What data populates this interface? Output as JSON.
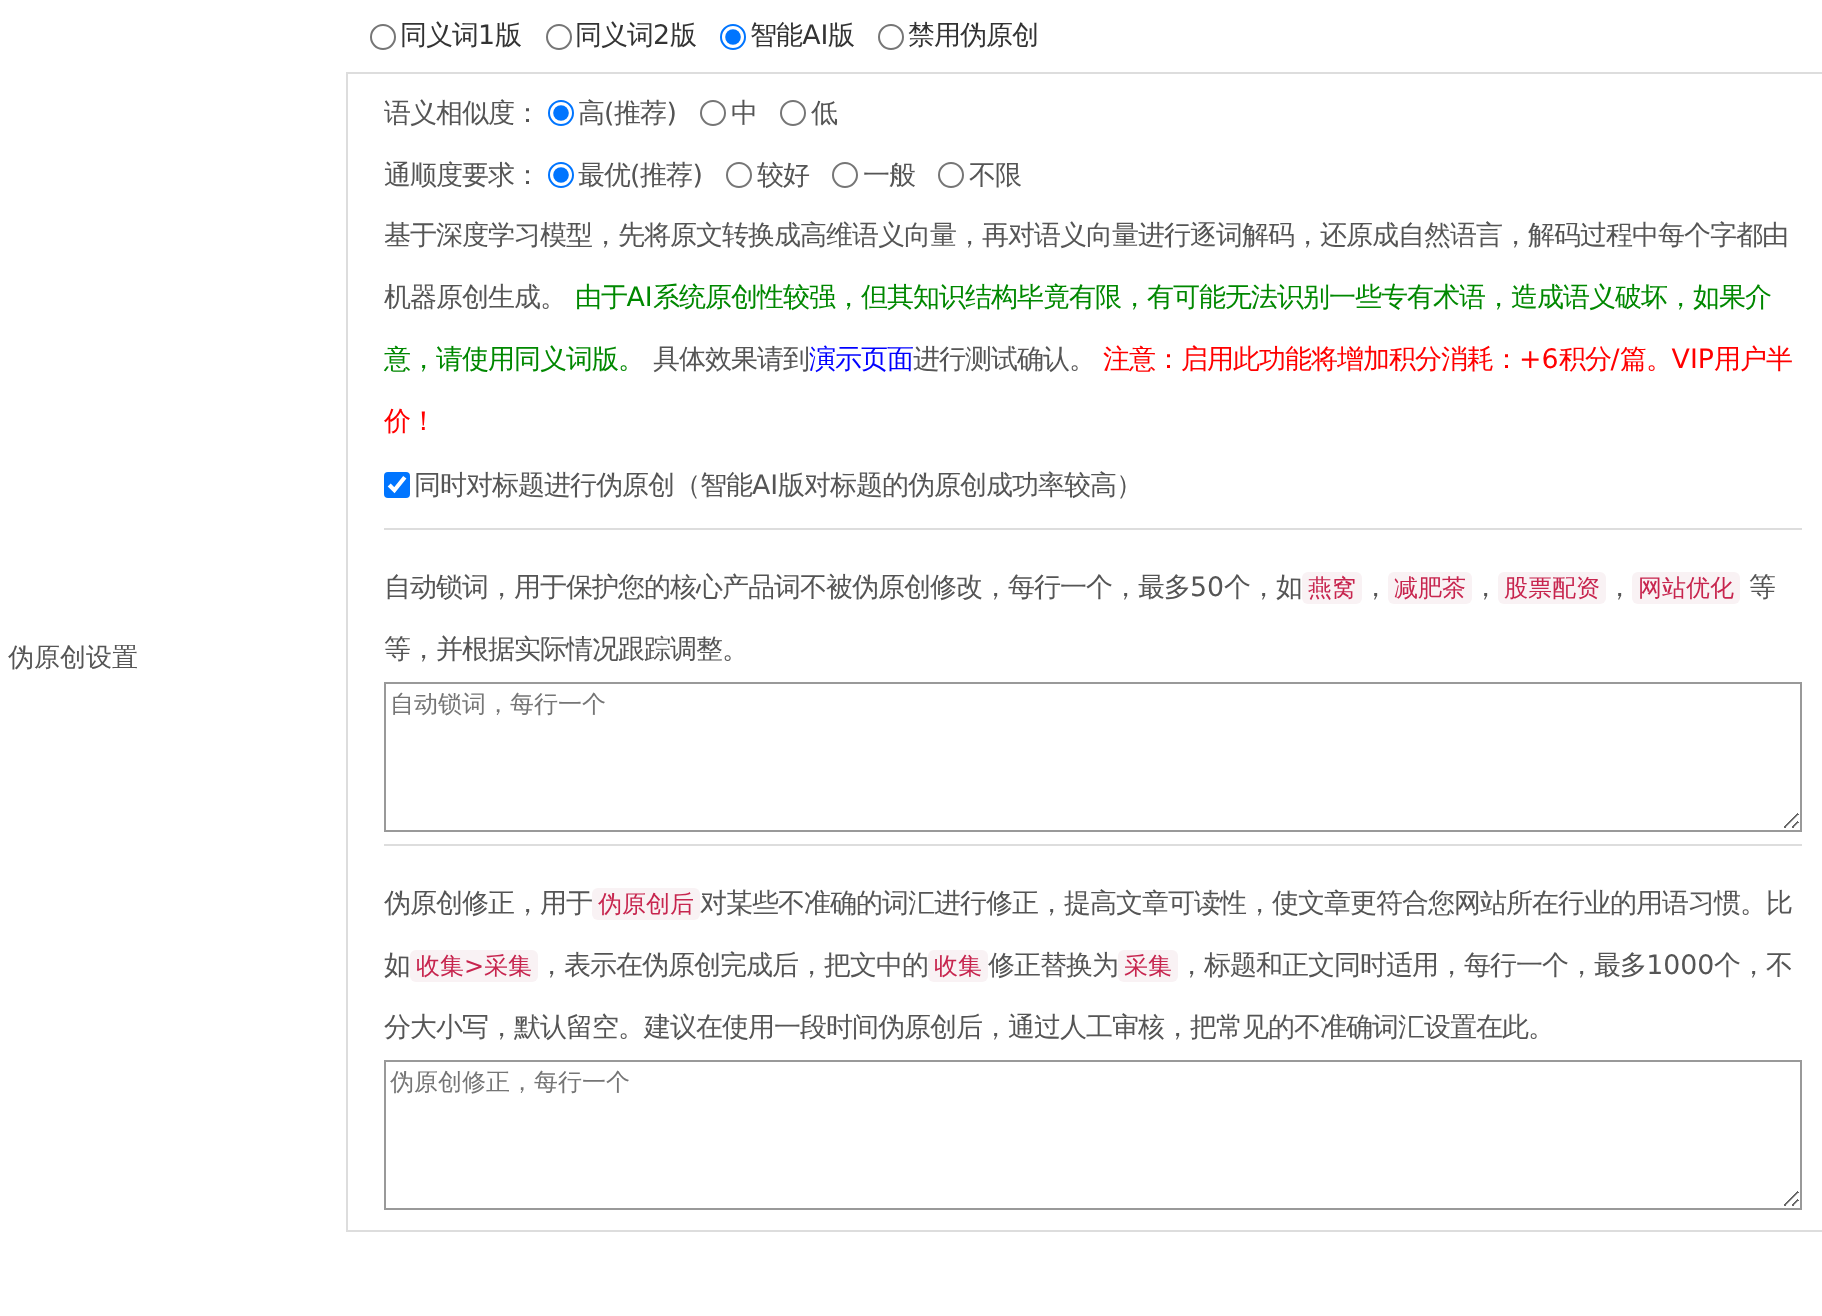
{
  "mode_options": [
    {
      "label": "同义词1版",
      "selected": false
    },
    {
      "label": "同义词2版",
      "selected": false
    },
    {
      "label": "智能AI版",
      "selected": true
    },
    {
      "label": "禁用伪原创",
      "selected": false
    }
  ],
  "settings_label": "伪原创设置",
  "similarity": {
    "label": "语义相似度：",
    "options": [
      {
        "label": "高(推荐)",
        "selected": true
      },
      {
        "label": "中",
        "selected": false
      },
      {
        "label": "低",
        "selected": false
      }
    ]
  },
  "fluency": {
    "label": "通顺度要求：",
    "options": [
      {
        "label": "最优(推荐)",
        "selected": true
      },
      {
        "label": "较好",
        "selected": false
      },
      {
        "label": "一般",
        "selected": false
      },
      {
        "label": "不限",
        "selected": false
      }
    ]
  },
  "description": [
    {
      "kind": "plain",
      "text": "基于深度学习模型，先将原文转换成高维语义向量，再对语义向量进行逐词解码，还原成自然语言，解码过程中每个字都由机器原创生成。 "
    },
    {
      "kind": "notice",
      "text": "由于AI系统原创性较强，但其知识结构毕竟有限，有可能无法识别一些专有术语，造成语义破坏，如果介意，请使用同义词版。"
    },
    {
      "kind": "plain",
      "text": " 具体效果请到"
    },
    {
      "kind": "link",
      "text": "演示页面"
    },
    {
      "kind": "plain",
      "text": "进行测试确认。 "
    },
    {
      "kind": "warning",
      "text": "注意：启用此功能将增加积分消耗：+6积分/篇。VIP用户半价！"
    }
  ],
  "title_checkbox": {
    "label": "同时对标题进行伪原创（智能AI版对标题的伪原创成功率较高）",
    "checked": true
  },
  "lock_words": {
    "description": [
      {
        "kind": "plain",
        "text": "自动锁词，用于保护您的核心产品词不被伪原创修改，每行一个，最多50个，如"
      },
      {
        "kind": "tag",
        "text": "燕窝"
      },
      {
        "kind": "plain",
        "text": "，"
      },
      {
        "kind": "tag",
        "text": "减肥茶"
      },
      {
        "kind": "plain",
        "text": "，"
      },
      {
        "kind": "tag",
        "text": "股票配资"
      },
      {
        "kind": "plain",
        "text": "，"
      },
      {
        "kind": "tag",
        "text": "网站优化"
      },
      {
        "kind": "plain",
        "text": " 等等，并根据实际情况跟踪调整。"
      }
    ],
    "placeholder": "自动锁词，每行一个"
  },
  "correction": {
    "description": [
      {
        "kind": "plain",
        "text": "伪原创修正，用于"
      },
      {
        "kind": "tag",
        "text": "伪原创后"
      },
      {
        "kind": "plain",
        "text": "对某些不准确的词汇进行修正，提高文章可读性，使文章更符合您网站所在行业的用语习惯。比如"
      },
      {
        "kind": "tag",
        "text": "收集>采集"
      },
      {
        "kind": "plain",
        "text": "，表示在伪原创完成后，把文中的"
      },
      {
        "kind": "tag",
        "text": "收集"
      },
      {
        "kind": "plain",
        "text": "修正替换为"
      },
      {
        "kind": "tag",
        "text": "采集"
      },
      {
        "kind": "plain",
        "text": "，标题和正文同时适用，每行一个，最多1000个，不分大小写，默认留空。建议在使用一段时间伪原创后，通过人工审核，把常见的不准确词汇设置在此。"
      }
    ],
    "placeholder": "伪原创修正，每行一个"
  }
}
